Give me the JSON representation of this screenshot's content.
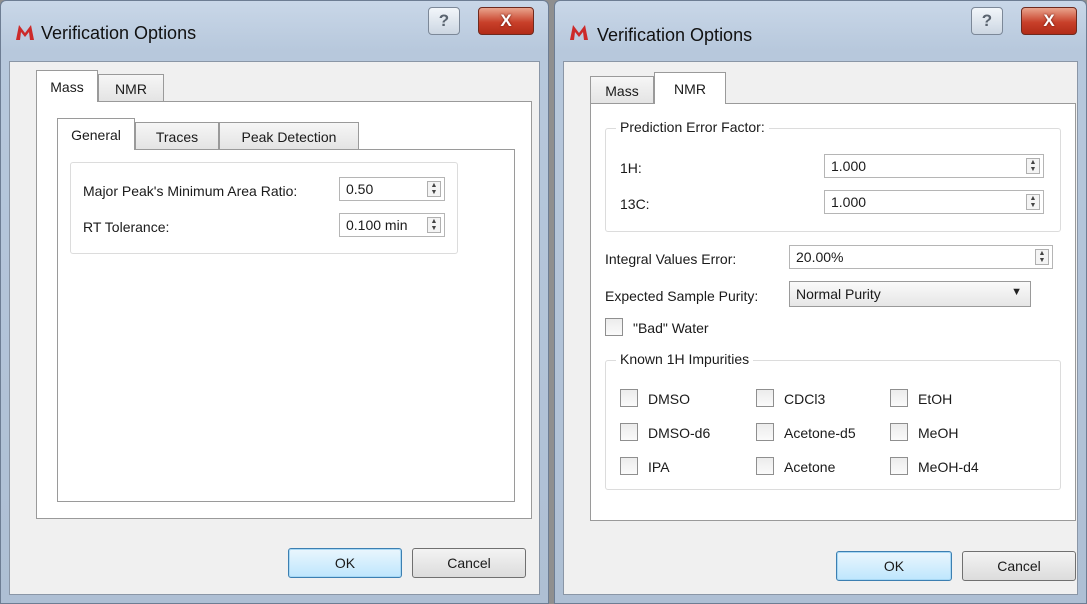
{
  "left_dialog": {
    "title": "Verification Options",
    "tabs": [
      "Mass",
      "NMR"
    ],
    "active_tab": "Mass",
    "subtabs": [
      "General",
      "Traces",
      "Peak Detection"
    ],
    "active_subtab": "General",
    "fields": [
      {
        "label": "Major Peak's Minimum Area Ratio:",
        "value": "0.50"
      },
      {
        "label": "RT Tolerance:",
        "value": "0.100 min"
      }
    ],
    "ok_label": "OK",
    "cancel_label": "Cancel"
  },
  "right_dialog": {
    "title": "Verification Options",
    "tabs": [
      "Mass",
      "NMR"
    ],
    "active_tab": "NMR",
    "prediction_group": {
      "title": "Prediction Error Factor:",
      "fields": [
        {
          "label": "1H:",
          "value": "1.000"
        },
        {
          "label": "13C:",
          "value": "1.000"
        }
      ]
    },
    "integral_error": {
      "label": "Integral Values Error:",
      "value": "20.00%"
    },
    "sample_purity": {
      "label": "Expected Sample Purity:",
      "value": "Normal Purity"
    },
    "bad_water": {
      "label": "\"Bad\" Water",
      "checked": false
    },
    "impurities_group": {
      "title": "Known 1H Impurities",
      "items": [
        {
          "label": "DMSO",
          "checked": false
        },
        {
          "label": "CDCl3",
          "checked": false
        },
        {
          "label": "EtOH",
          "checked": false
        },
        {
          "label": "DMSO-d6",
          "checked": false
        },
        {
          "label": "Acetone-d5",
          "checked": false
        },
        {
          "label": "MeOH",
          "checked": false
        },
        {
          "label": "IPA",
          "checked": false
        },
        {
          "label": "Acetone",
          "checked": false
        },
        {
          "label": "MeOH-d4",
          "checked": false
        }
      ]
    },
    "ok_label": "OK",
    "cancel_label": "Cancel"
  },
  "caption_buttons": {
    "help": "?",
    "close": "X"
  },
  "icons": {
    "app": "mnova-app-icon",
    "spin_up": "▲",
    "spin_down": "▼",
    "combo_arrow": "▼"
  },
  "colors": {
    "app_icon_red": "#cc2a2a",
    "close_red": "#c8402a",
    "default_button": "#bee6fd"
  }
}
